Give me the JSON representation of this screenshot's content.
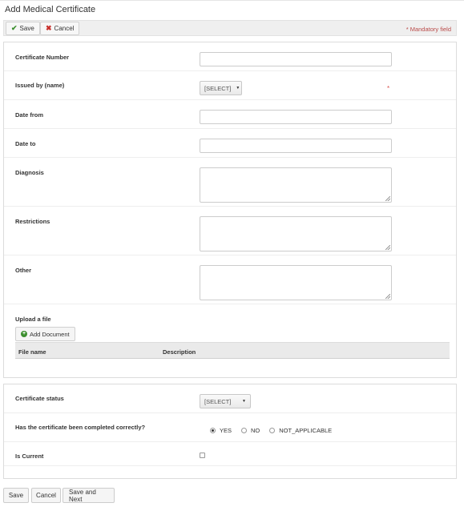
{
  "page": {
    "title": "Add Medical Certificate"
  },
  "toolbar": {
    "save_label": "Save",
    "cancel_label": "Cancel",
    "mandatory_note": "* Mandatory field"
  },
  "form": {
    "certificate_number": {
      "label": "Certificate Number",
      "value": ""
    },
    "issued_by": {
      "label": "Issued by (name)",
      "selected": "[SELECT]",
      "required_mark": "*"
    },
    "date_from": {
      "label": "Date from",
      "value": ""
    },
    "date_to": {
      "label": "Date to",
      "value": ""
    },
    "diagnosis": {
      "label": "Diagnosis",
      "value": ""
    },
    "restrictions": {
      "label": "Restrictions",
      "value": ""
    },
    "other": {
      "label": "Other",
      "value": ""
    },
    "upload": {
      "label": "Upload a file",
      "add_document_label": "Add Document",
      "columns": [
        "File name",
        "Description"
      ]
    }
  },
  "status_section": {
    "certificate_status": {
      "label": "Certificate status",
      "selected": "[SELECT]"
    },
    "completed_correctly": {
      "label": "Has the certificate been completed correctly?",
      "options": [
        "YES",
        "NO",
        "NOT_APPLICABLE"
      ],
      "selected": "YES"
    },
    "is_current": {
      "label": "Is Current",
      "checked": false
    }
  },
  "footer": {
    "save_label": "Save",
    "cancel_label": "Cancel",
    "save_next_label": "Save and Next"
  },
  "colors": {
    "accent_green": "#3c8f2f",
    "cancel_red": "#c9302c",
    "mandatory_red": "#b94a48"
  }
}
